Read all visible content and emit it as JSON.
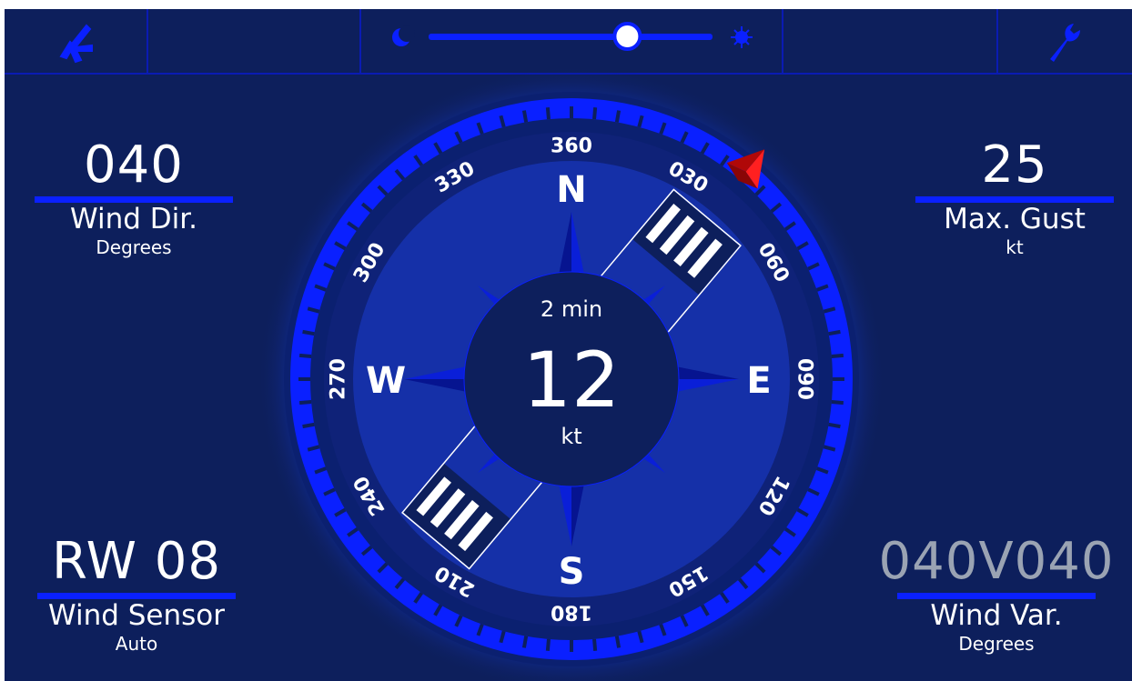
{
  "colors": {
    "background": "#0d1f5c",
    "accent": "#0a20ff",
    "text": "#ffffff",
    "muted_text": "#9aa3b3",
    "wind_arrow": "#e01010"
  },
  "topbar": {
    "left_icon": "turbine-icon",
    "right_icon": "wrench-icon",
    "brightness": {
      "min_icon": "moon-icon",
      "max_icon": "sun-icon",
      "value": 0.7
    }
  },
  "wind_dir": {
    "value": "040",
    "label": "Wind Dir.",
    "unit": "Degrees"
  },
  "max_gust": {
    "value": "25",
    "label": "Max. Gust",
    "unit": "kt"
  },
  "wind_sensor": {
    "value": "RW 08",
    "label": "Wind Sensor",
    "unit": "Auto"
  },
  "wind_var": {
    "value": "040V040",
    "label": "Wind Var.",
    "unit": "Degrees"
  },
  "compass": {
    "center_period": "2 min",
    "center_speed": "12",
    "center_unit": "kt",
    "wind_direction_deg": 40,
    "runway_heading_deg": 40,
    "cardinals": {
      "n": "N",
      "e": "E",
      "s": "S",
      "w": "W"
    },
    "degree_labels": [
      {
        "text": "360",
        "deg": 0
      },
      {
        "text": "030",
        "deg": 30
      },
      {
        "text": "060",
        "deg": 60
      },
      {
        "text": "090",
        "deg": 90
      },
      {
        "text": "120",
        "deg": 120
      },
      {
        "text": "150",
        "deg": 150
      },
      {
        "text": "180",
        "deg": 180
      },
      {
        "text": "210",
        "deg": 210
      },
      {
        "text": "240",
        "deg": 240
      },
      {
        "text": "270",
        "deg": 270
      },
      {
        "text": "300",
        "deg": 300
      },
      {
        "text": "330",
        "deg": 330
      }
    ]
  }
}
